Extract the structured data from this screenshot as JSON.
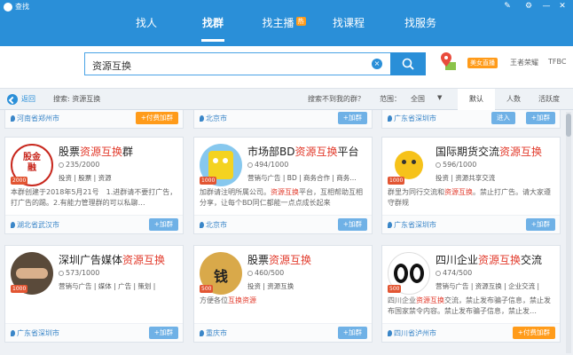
{
  "app": {
    "title": "查找"
  },
  "nav": {
    "tabs": [
      {
        "label": "找人"
      },
      {
        "label": "找群"
      },
      {
        "label": "找主播",
        "badge": "热"
      },
      {
        "label": "找课程"
      },
      {
        "label": "找服务"
      }
    ]
  },
  "search": {
    "value": "资源互换",
    "clear_icon": "×"
  },
  "header_links": {
    "live": "美女直播",
    "user": "王者荣耀",
    "extra": "TFBC"
  },
  "filter": {
    "back": "返回",
    "search_label": "搜索: 资源互换",
    "not_found": "搜索不到我的群？",
    "range_label": "范围：",
    "range_value": "全国",
    "sorts": [
      "默认",
      "人数",
      "活跃度"
    ]
  },
  "top_row": [
    {
      "location": "河南省郑州市",
      "button": "+付费加群"
    },
    {
      "location": "北京市",
      "button": "+加群"
    },
    {
      "location": "广东省深圳市",
      "button2": "进入",
      "button": "+加群"
    }
  ],
  "groups": [
    {
      "name_pre": "股票",
      "name_hl": "资源互换",
      "name_post": "群",
      "count": "235/2000",
      "tags": "投资 | 股票 | 资源",
      "desc_pre": "本群创建于2018年5月21号　1.进群请不要打广告，打广告的踢。2.有能力管理群的可以私聊…",
      "desc_hl": "",
      "desc_post": "",
      "location": "湖北省武汉市",
      "button": "+加群",
      "badge": "2000"
    },
    {
      "name_pre": "市场部BD",
      "name_hl": "资源互换",
      "name_post": "平台",
      "count": "494/1000",
      "tags": "营销与广告 | BD | 商务合作 | 商务…",
      "desc_pre": "加群请注明所属公司。",
      "desc_hl": "资源互换",
      "desc_post": "平台，互相帮助互相分享，让每个BD同仁都能一点点成长起来",
      "location": "北京市",
      "button": "+加群",
      "badge": "1000"
    },
    {
      "name_pre": "国际期货交流",
      "name_hl": "资源互换",
      "name_post": "",
      "count": "596/1000",
      "tags": "投资 | 资源共享交流",
      "desc_pre": "群里为同行交流和",
      "desc_hl": "资源互换",
      "desc_post": "。禁止打广告。请大家遵守群规",
      "location": "广东省深圳市",
      "button": "+加群",
      "badge": "1000"
    },
    {
      "name_pre": "深圳广告媒体",
      "name_hl": "资源互换",
      "name_post": "",
      "count": "573/1000",
      "tags": "营销与广告 | 媒体 | 广告 | 策划 |",
      "desc_pre": "",
      "desc_hl": "",
      "desc_post": "",
      "location": "广东省深圳市",
      "button": "+加群",
      "badge": "1000"
    },
    {
      "name_pre": "股票",
      "name_hl": "资源互换",
      "name_post": "",
      "count": "460/500",
      "tags": "投资 | 资源互换",
      "desc_pre": "方便各位",
      "desc_hl": "互换资源",
      "desc_post": "",
      "location": "重庆市",
      "button": "+加群",
      "badge": "500"
    },
    {
      "name_pre": "四川企业",
      "name_hl": "资源互换",
      "name_post": "交流",
      "count": "474/500",
      "tags": "营销与广告 | 资源互换 | 企业交流 |",
      "desc_pre": "四川企业",
      "desc_hl": "资源互换",
      "desc_post": "交流，禁止发布骗子信息，禁止发布国家禁令内容。禁止发布骗子信息，禁止发…",
      "location": "四川省泸州市",
      "button": "+付费加群",
      "badge": "500"
    }
  ]
}
